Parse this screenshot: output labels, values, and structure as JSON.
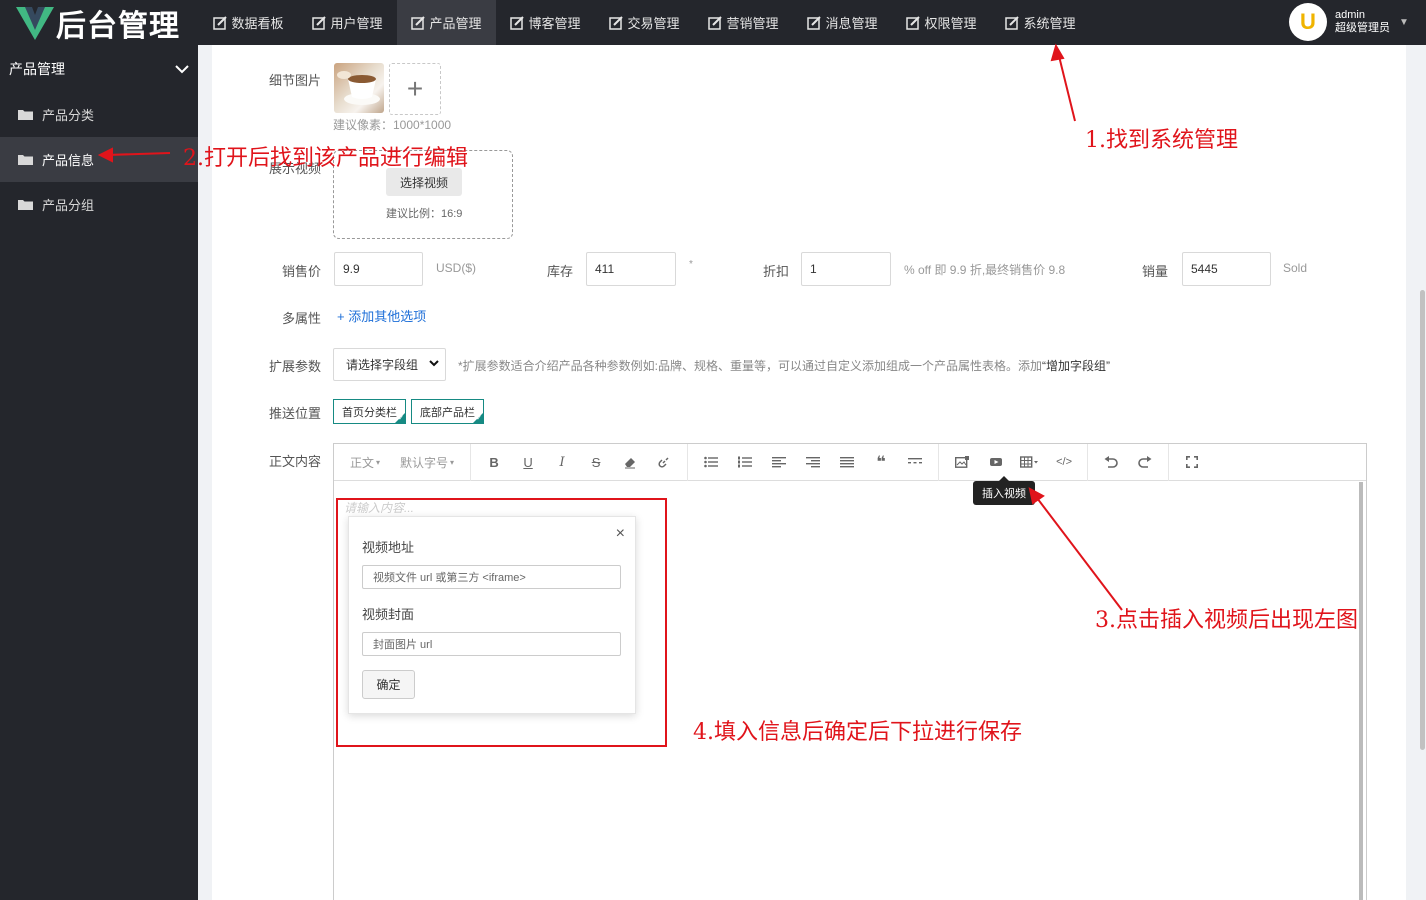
{
  "app": {
    "logo_text": "后台管理"
  },
  "nav": {
    "items": [
      {
        "label": "数据看板"
      },
      {
        "label": "用户管理"
      },
      {
        "label": "产品管理"
      },
      {
        "label": "博客管理"
      },
      {
        "label": "交易管理"
      },
      {
        "label": "营销管理"
      },
      {
        "label": "消息管理"
      },
      {
        "label": "权限管理"
      },
      {
        "label": "系统管理"
      }
    ],
    "active": "产品管理"
  },
  "user": {
    "avatar_letter": "U",
    "name": "admin",
    "role": "超级管理员"
  },
  "sidebar": {
    "title": "产品管理",
    "items": [
      {
        "label": "产品分类"
      },
      {
        "label": "产品信息"
      },
      {
        "label": "产品分组"
      }
    ],
    "active": "产品信息"
  },
  "form": {
    "detail_images_label": "细节图片",
    "detail_images_hint": "建议像素：1000*1000",
    "video_label": "展示视频",
    "video_button": "选择视频",
    "video_hint": "建议比例：16:9",
    "price_label": "销售价",
    "price_value": "9.9",
    "price_unit": "USD($)",
    "stock_label": "库存",
    "stock_value": "411",
    "stock_required": "*",
    "discount_label": "折扣",
    "discount_value": "1",
    "discount_hint": "% off 即 9.9 折,最终销售价 9.8",
    "sales_label": "销量",
    "sales_value": "5445",
    "sales_unit": "Sold",
    "attr_label": "多属性",
    "attr_add": "添加其他选项",
    "ext_label": "扩展参数",
    "ext_select": "请选择字段组",
    "ext_hint": "*扩展参数适合介绍产品各种参数例如:品牌、规格、重量等，可以通过自定义添加组成一个产品属性表格。添加",
    "ext_hint_bold": "“增加字段组”",
    "push_label": "推送位置",
    "push_tags": [
      {
        "label": "首页分类栏"
      },
      {
        "label": "底部产品栏"
      }
    ],
    "body_label": "正文内容"
  },
  "editor": {
    "heading_drop": "正文",
    "size_drop": "默认字号",
    "placeholder": "请输入内容...",
    "tooltip": "插入视频",
    "modal": {
      "url_label": "视频地址",
      "url_placeholder": "视频文件 url 或第三方 <iframe>",
      "cover_label": "视频封面",
      "cover_placeholder": "封面图片 url",
      "confirm": "确定",
      "close": "×"
    }
  },
  "annotations": {
    "step1": "1.找到系统管理",
    "step2": "2.打开后找到该产品进行编辑",
    "step3": "3.点击插入视频后出现左图",
    "step4": "4.填入信息后确定后下拉进行保存",
    "color": "#e0141b"
  }
}
